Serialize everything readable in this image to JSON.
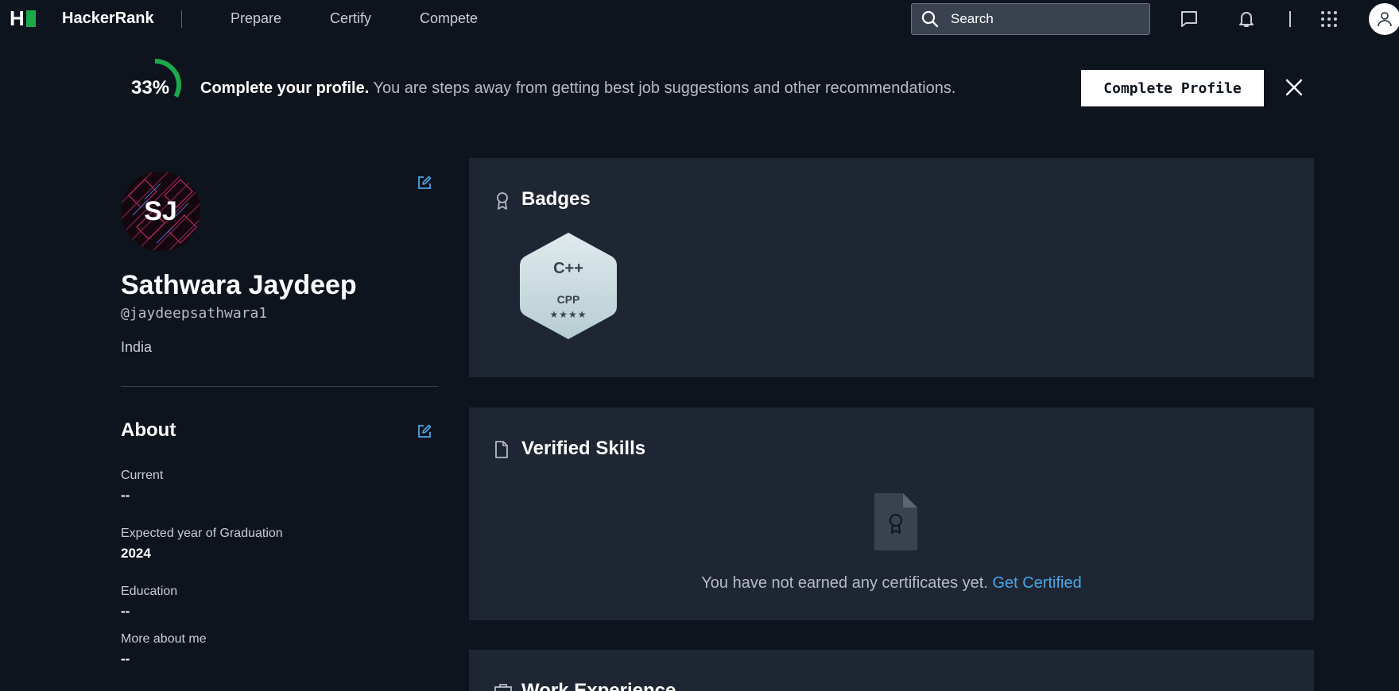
{
  "nav": {
    "logo_letter": "H",
    "brand": "HackerRank",
    "links": [
      "Prepare",
      "Certify",
      "Compete"
    ],
    "search_placeholder": "Search",
    "icons": [
      "search-icon",
      "chat-icon",
      "bell-icon",
      "apps-grid-icon",
      "user-icon"
    ]
  },
  "banner": {
    "progress_percent": 33,
    "progress_label": "33%",
    "bold_text": "Complete your profile.",
    "rest_text": " You are steps away from getting best job suggestions and other recommendations.",
    "button_label": "Complete Profile"
  },
  "profile": {
    "initials": "SJ",
    "name": "Sathwara Jaydeep",
    "handle": "@jaydeepsathwara1",
    "country": "India"
  },
  "about": {
    "title": "About",
    "fields": [
      {
        "label": "Current",
        "value": "--"
      },
      {
        "label": "Expected year of Graduation",
        "value": "2024"
      },
      {
        "label": "Education",
        "value": "--"
      },
      {
        "label": "More about me",
        "value": "--"
      }
    ]
  },
  "badges": {
    "title": "Badges",
    "items": [
      {
        "logo": "C++",
        "name": "CPP",
        "stars": 4,
        "stars_text": "★★★★"
      }
    ]
  },
  "verified_skills": {
    "title": "Verified Skills",
    "empty_text": "You have not earned any certificates yet. ",
    "link_text": "Get Certified"
  },
  "work_experience": {
    "title": "Work Experience"
  },
  "colors": {
    "background": "#0e141e",
    "card": "#1f2633",
    "accent_green": "#1ba94c",
    "link_blue": "#4aa6e6"
  }
}
